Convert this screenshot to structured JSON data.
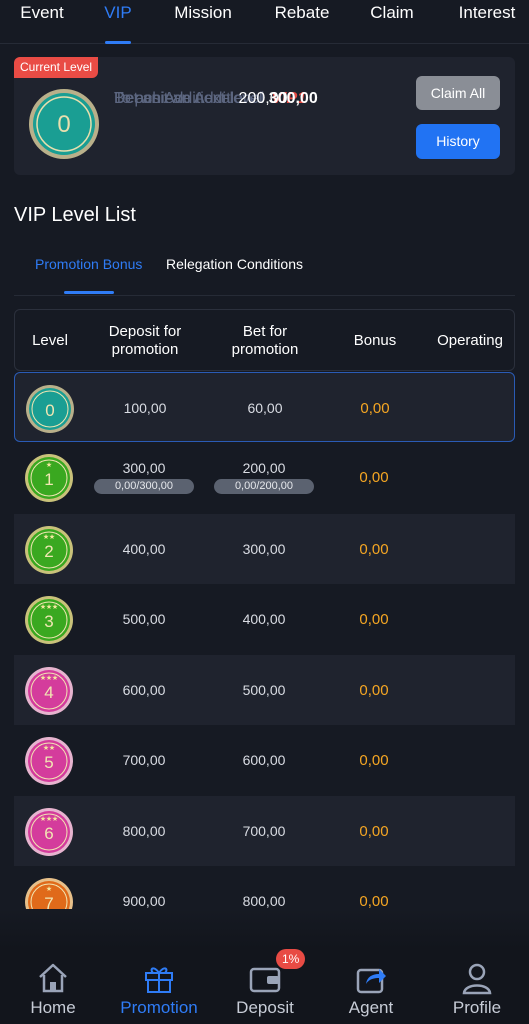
{
  "top_tabs": [
    {
      "label": "Event"
    },
    {
      "label": "VIP"
    },
    {
      "label": "Mission"
    },
    {
      "label": "Rebate"
    },
    {
      "label": "Claim"
    },
    {
      "label": "Interest"
    }
  ],
  "current_level_card": {
    "badge": "Current Level",
    "medal_level": "0",
    "line1_label": "To achieve next level",
    "line1_value": "VIP1",
    "line2_label": "Deposit an Additional",
    "line2_value": "300,00",
    "line3_label": "Bet an Additional",
    "line3_value": "200,00",
    "claim_all": "Claim All",
    "history": "History"
  },
  "section_title": "VIP Level List",
  "sub_tabs": [
    {
      "label": "Promotion Bonus"
    },
    {
      "label": "Relegation Conditions"
    }
  ],
  "table": {
    "headers": {
      "level": "Level",
      "deposit": "Deposit for promotion",
      "bet": "Bet for promotion",
      "bonus": "Bonus",
      "operating": "Operating"
    },
    "rows": [
      {
        "level": "0",
        "deposit": "100,00",
        "bet": "60,00",
        "bonus": "0,00"
      },
      {
        "level": "1",
        "deposit": "300,00",
        "bet": "200,00",
        "bonus": "0,00",
        "deposit_progress": "0,00/300,00",
        "bet_progress": "0,00/200,00"
      },
      {
        "level": "2",
        "deposit": "400,00",
        "bet": "300,00",
        "bonus": "0,00"
      },
      {
        "level": "3",
        "deposit": "500,00",
        "bet": "400,00",
        "bonus": "0,00"
      },
      {
        "level": "4",
        "deposit": "600,00",
        "bet": "500,00",
        "bonus": "0,00"
      },
      {
        "level": "5",
        "deposit": "700,00",
        "bet": "600,00",
        "bonus": "0,00"
      },
      {
        "level": "6",
        "deposit": "800,00",
        "bet": "700,00",
        "bonus": "0,00"
      },
      {
        "level": "7",
        "deposit": "900,00",
        "bet": "800,00",
        "bonus": "0,00"
      }
    ]
  },
  "bottom_nav": [
    {
      "label": "Home",
      "icon": "home-icon"
    },
    {
      "label": "Promotion",
      "icon": "gift-icon"
    },
    {
      "label": "Deposit",
      "icon": "wallet-icon"
    },
    {
      "label": "Agent",
      "icon": "share-icon"
    },
    {
      "label": "Profile",
      "icon": "user-icon"
    }
  ],
  "deposit_badge": "1%",
  "colors": {
    "accent": "#2f7cf6",
    "background": "#161a23",
    "bonus": "#f5a623",
    "badge_red": "#e84b44"
  }
}
